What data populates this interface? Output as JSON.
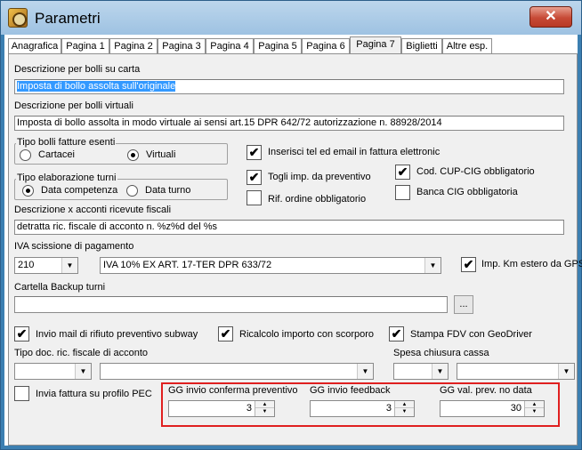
{
  "window": {
    "title": "Parametri",
    "close_glyph": "✕"
  },
  "tabs": [
    {
      "label": "Anagrafica"
    },
    {
      "label": "Pagina 1"
    },
    {
      "label": "Pagina 2"
    },
    {
      "label": "Pagina 3"
    },
    {
      "label": "Pagina 4"
    },
    {
      "label": "Pagina 5"
    },
    {
      "label": "Pagina 6"
    },
    {
      "label": "Pagina 7",
      "active": true
    },
    {
      "label": "Biglietti"
    },
    {
      "label": "Altre esp."
    }
  ],
  "bolli_carta": {
    "label": "Descrizione per bolli su carta",
    "value": "Imposta di bollo assolta sull'originale"
  },
  "bolli_virtuali": {
    "label": "Descrizione per bolli virtuali",
    "value": "Imposta di bollo assolta in modo virtuale ai sensi art.15 DPR 642/72 autorizzazione n. 88928/2014"
  },
  "tipo_bolli": {
    "title": "Tipo bolli fatture esenti",
    "options": [
      {
        "label": "Cartacei",
        "selected": false
      },
      {
        "label": "Virtuali",
        "selected": true
      }
    ]
  },
  "tipo_elaborazione": {
    "title": "Tipo elaborazione turni",
    "options": [
      {
        "label": "Data competenza",
        "selected": true
      },
      {
        "label": "Data turno",
        "selected": false
      }
    ]
  },
  "checks": {
    "inserisci_tel": {
      "label": "Inserisci tel ed email in fattura elettronic",
      "checked": true
    },
    "togli_imp": {
      "label": "Togli imp. da preventivo",
      "checked": true
    },
    "cod_cup": {
      "label": "Cod. CUP-CIG obbligatorio",
      "checked": true
    },
    "rif_ordine": {
      "label": "Rif. ordine obbligatorio",
      "checked": false
    },
    "banca_cig": {
      "label": "Banca CIG obbligatoria",
      "checked": false
    },
    "imp_km": {
      "label": "Imp. Km estero da GPS",
      "checked": true
    },
    "invio_mail": {
      "label": "Invio mail di rifiuto preventivo subway",
      "checked": true
    },
    "ricalcolo": {
      "label": "Ricalcolo importo con scorporo",
      "checked": true
    },
    "stampa_fdv": {
      "label": "Stampa FDV con GeoDriver",
      "checked": true
    },
    "invia_pec": {
      "label": "Invia fattura su profilo PEC",
      "checked": false
    }
  },
  "descrizione_acconti": {
    "label": "Descrizione x acconti ricevute fiscali",
    "value": "detratta ric. fiscale di acconto n. %z%d del %s"
  },
  "iva_scissione": {
    "label": "IVA scissione di pagamento",
    "code": "210",
    "description": "IVA 10% EX ART. 17-TER DPR 633/72"
  },
  "cartella_backup": {
    "label": "Cartella Backup turni",
    "value": "",
    "browse_label": "..."
  },
  "tipo_doc": {
    "label": "Tipo doc. ric. fiscale di acconto"
  },
  "spesa_chiusura": {
    "label": "Spesa chiusura cassa"
  },
  "gg_fields": [
    {
      "label": "GG invio conferma preventivo",
      "value": "3"
    },
    {
      "label": "GG invio feedback",
      "value": "3"
    },
    {
      "label": "GG val. prev. no data",
      "value": "30"
    }
  ],
  "icons": {
    "check": "✔",
    "arrow_down": "▼",
    "arrow_up": "▲"
  }
}
